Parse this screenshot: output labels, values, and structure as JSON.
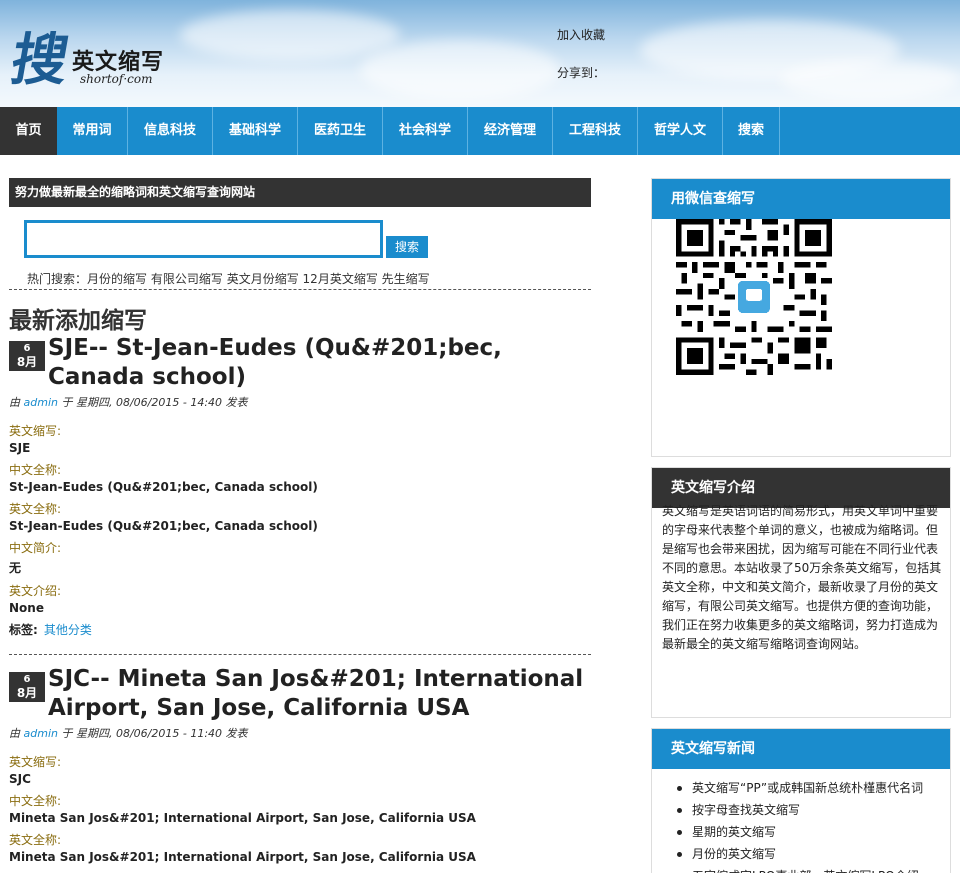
{
  "header": {
    "logo_char": "搜",
    "logo_title": "英文缩写",
    "logo_sub": "shortof·com",
    "bookmark": "加入收藏",
    "share": "分享到："
  },
  "nav": [
    "首页",
    "常用词",
    "信息科技",
    "基础科学",
    "医药卫生",
    "社会科学",
    "经济管理",
    "工程科技",
    "哲学人文",
    "搜索"
  ],
  "main": {
    "slogan": "努力做最新最全的缩略词和英文缩写查询网站",
    "search": {
      "value": "",
      "button": "搜索"
    },
    "hot_label": "热门搜索：",
    "hot": [
      "月份的缩写",
      "有限公司缩写",
      "英文月份缩写",
      "12月英文缩写",
      "先生缩写"
    ],
    "latest_title": "最新添加缩写"
  },
  "posts": [
    {
      "day": "6",
      "month": "8月",
      "title": "SJE-- St-Jean-Eudes (Qu&#201;bec, Canada school)",
      "meta_prefix": "由",
      "author": "admin",
      "meta_suffix": "于 星期四, 08/06/2015 - 14:40 发表",
      "fields": [
        {
          "label": "英文缩写:",
          "value": "SJE"
        },
        {
          "label": "中文全称:",
          "value": "St-Jean-Eudes (Qu&#201;bec, Canada school)"
        },
        {
          "label": "英文全称:",
          "value": "St-Jean-Eudes (Qu&#201;bec, Canada school)"
        },
        {
          "label": "中文简介:",
          "value": "无"
        },
        {
          "label": "英文介绍:",
          "value": "None"
        }
      ],
      "tag_label": "标签:",
      "tag": "其他分类"
    },
    {
      "day": "6",
      "month": "8月",
      "title": "SJC-- Mineta San Jos&#201; International Airport, San Jose, California USA",
      "meta_prefix": "由",
      "author": "admin",
      "meta_suffix": "于 星期四, 08/06/2015 - 11:40 发表",
      "fields": [
        {
          "label": "英文缩写:",
          "value": "SJC"
        },
        {
          "label": "中文全称:",
          "value": "Mineta San Jos&#201; International Airport, San Jose, California USA"
        },
        {
          "label": "英文全称:",
          "value": "Mineta San Jos&#201; International Airport, San Jose, California USA"
        }
      ]
    }
  ],
  "sidebar": {
    "wechat_title": "用微信查缩写",
    "intro_title": "英文缩写介绍",
    "intro_text": "英文缩写是英语词语的简易形式，用英文单词中重要的字母来代表整个单词的意义，也被成为缩略词。但是缩写也会带来困扰，因为缩写可能在不同行业代表不同的意思。本站收录了50万余条英文缩写，包括其英文全称，中文和英文简介，最新收录了月份的英文缩写，有限公司英文缩写。也提供方便的查询功能，我们正在努力收集更多的英文缩略词，努力打造成为最新最全的英文缩写缩略词查询网站。",
    "news_title": "英文缩写新闻",
    "news": [
      "英文缩写“PP”或成韩国新总统朴槿惠代名词",
      "按字母查找英文缩写",
      "星期的英文缩写",
      "月份的英文缩写",
      "五官缩成字LPO事业部，英文缩写LPO介绍"
    ]
  },
  "colors": {
    "accent": "#1a8ccd",
    "dark": "#333333",
    "label": "#8a6d10"
  }
}
